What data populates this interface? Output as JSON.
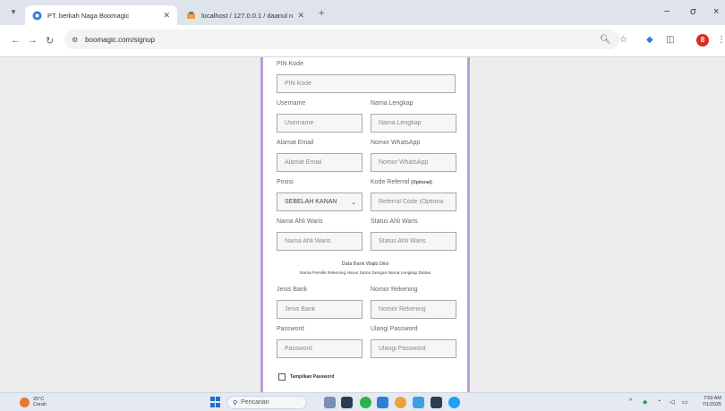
{
  "browser": {
    "tabs": [
      {
        "title": "PT. berkah Naga Boomagic",
        "active": true
      },
      {
        "title": "localhost / 127.0.0.1 / daanul n",
        "active": false
      }
    ],
    "url": "boomagic.com/signup",
    "new_tab_label": "+",
    "profile_initial": "8",
    "minimize": "−",
    "maximize": "σ",
    "close": "×"
  },
  "form": {
    "pin": {
      "label": "PIN Kode",
      "placeholder": "PIN Kode"
    },
    "username": {
      "label": "Username",
      "placeholder": "Username"
    },
    "fullname": {
      "label": "Nama Lengkap",
      "placeholder": "Nama Lengkap"
    },
    "email": {
      "label": "Alamat Email",
      "placeholder": "Alamat Email"
    },
    "whatsapp": {
      "label": "Nomor WhatsApp",
      "placeholder": "Nomor WhatsApp"
    },
    "position": {
      "label": "Posisi",
      "value": "SEBELAH KANAN"
    },
    "referral": {
      "label": "Kode Referral",
      "optional": "(Optional)",
      "placeholder": "Referral Code (Optiona"
    },
    "heir_name": {
      "label": "Nama Ahli Waris",
      "placeholder": "Nama Ahli Waris"
    },
    "heir_status": {
      "label": "Status Ahli Waris",
      "placeholder": "Status Ahli Waris"
    },
    "bank_note_title": "Data Bank Wajib Diisi",
    "bank_note_sub": "Nama Pemilik Rekening Harus Sama Dengan Nama Lengkap Diatas",
    "bank_type": {
      "label": "Jenis Bank",
      "placeholder": "Jenis Bank"
    },
    "account_number": {
      "label": "Nomor Rekening",
      "placeholder": "Nomor Rekening"
    },
    "password": {
      "label": "Password",
      "placeholder": "Password"
    },
    "password_repeat": {
      "label": "Ulangi Password",
      "placeholder": "Ulangi Password"
    },
    "show_password": "Tampilkan Password"
  },
  "taskbar": {
    "weather_temp": "25°C",
    "weather_desc": "Cerah",
    "search_placeholder": "Pencarian",
    "clock_time": "7:59 AM",
    "clock_date": "7/1/2025"
  }
}
